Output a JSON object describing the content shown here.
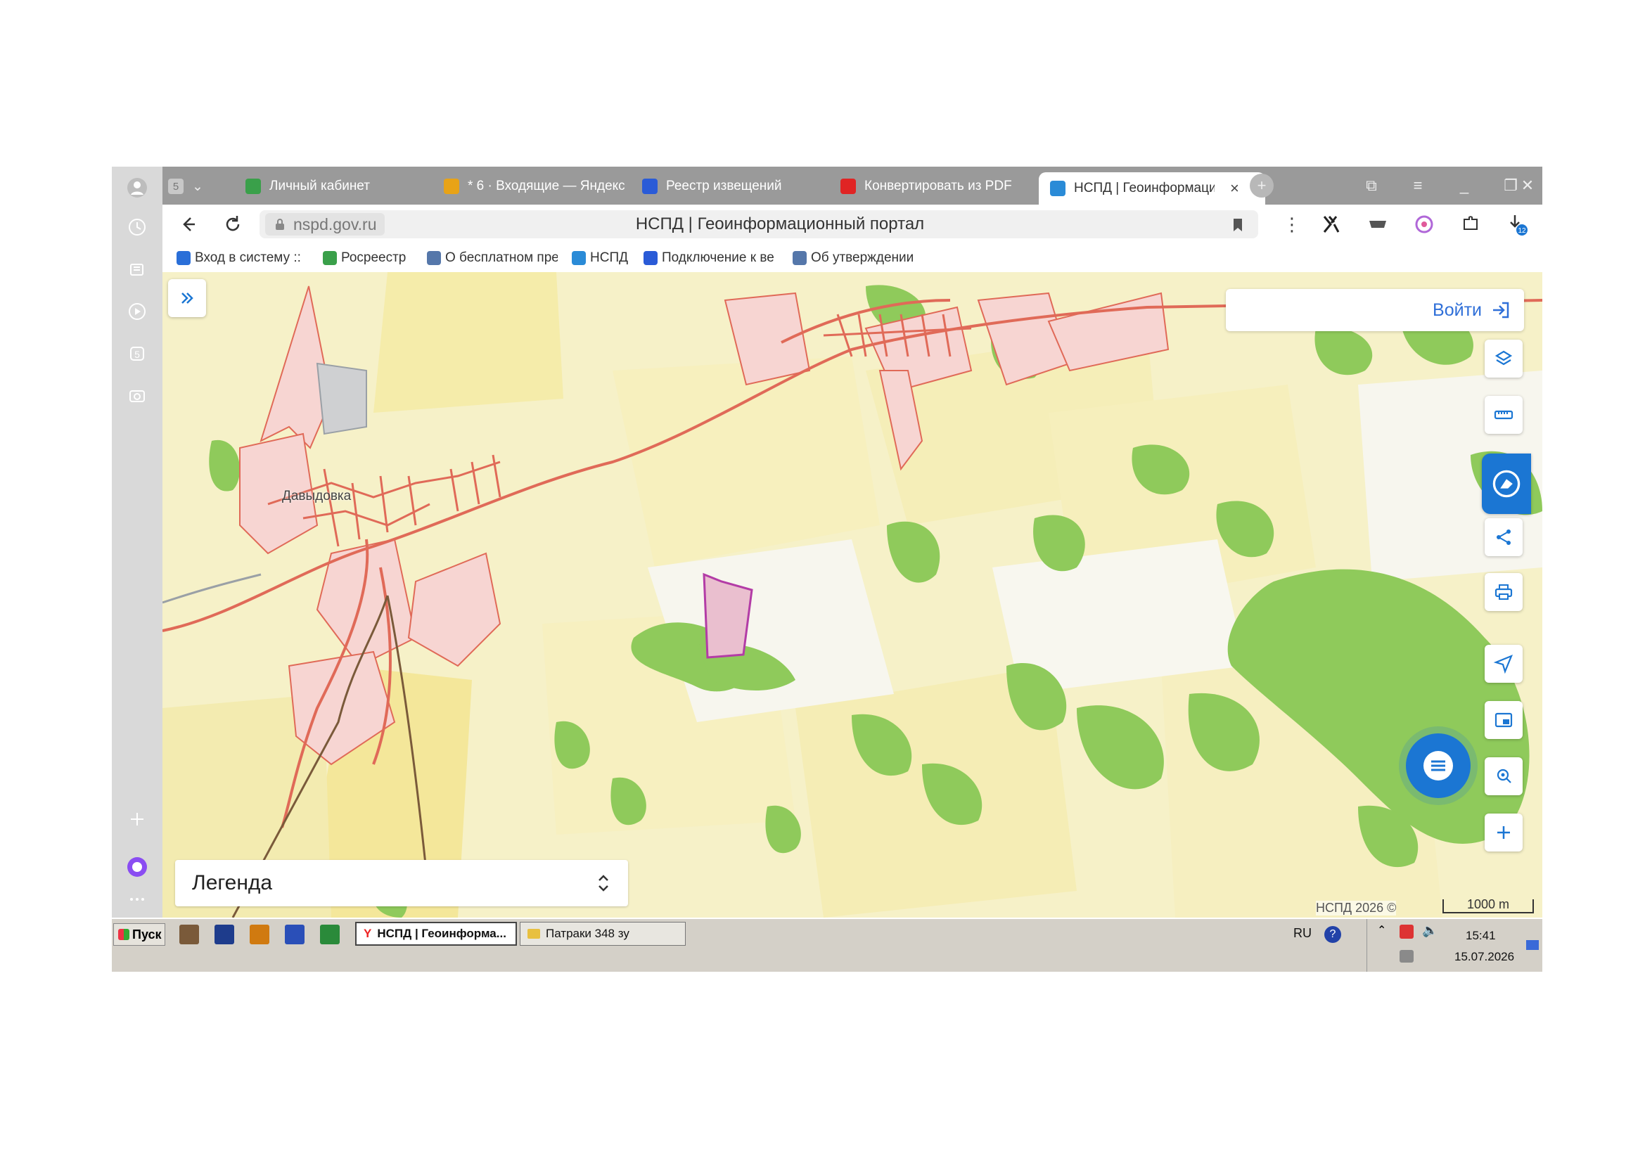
{
  "browser": {
    "tabs": [
      {
        "label": "Личный кабинет",
        "color": "#3aa04a"
      },
      {
        "label": "* 6 · Входящие — Яндекс",
        "color": "#e8a317"
      },
      {
        "label": "Реестр извещений",
        "color": "#2a5bd7"
      },
      {
        "label": "Конвертировать из PDF",
        "color": "#e02424"
      },
      {
        "label": "НСПД | Геоинформационный портал",
        "color": "#2a8bd7",
        "active": true
      }
    ],
    "sidebar_badge": "5",
    "url": "nspd.gov.ru",
    "page_title": "НСПД | Геоинформационный портал",
    "downloads_badge": "12",
    "bookmarks": [
      {
        "label": "Вход в систему ::",
        "color": "#2a6fd8"
      },
      {
        "label": "Росреестр",
        "color": "#3aa04a"
      },
      {
        "label": "О бесплатном пре",
        "color": "#5577aa"
      },
      {
        "label": "НСПД",
        "color": "#2a8bd7"
      },
      {
        "label": "Подключение к ве",
        "color": "#2a5bd7"
      },
      {
        "label": "Об утверждении",
        "color": "#5577aa"
      }
    ]
  },
  "map": {
    "place_label": "Давыдовка",
    "login_label": "Войти",
    "legend_label": "Легенда",
    "copyright": "НСПД 2026 ©",
    "scale_label": "1000 m",
    "tools": [
      "layers-icon",
      "ruler-icon",
      "assistant-icon",
      "share-icon",
      "print-icon",
      "locate-icon",
      "minimap-icon",
      "search-location-icon",
      "zoom-in-icon"
    ],
    "colors": {
      "fields": "#f5efbf",
      "forest": "#8fca5b",
      "settlement": "#f7d5d2",
      "road": "#e06a58",
      "parcel": "#b33ca6",
      "accent": "#1b76d3"
    }
  },
  "taskbar": {
    "start_label": "Пуск",
    "windows": [
      {
        "label": "НСПД | Геоинформа...",
        "active": true
      },
      {
        "label": "Патраки 348 зу",
        "active": false
      }
    ],
    "lang": "RU",
    "time": "15:41",
    "date": "15.07.2026"
  }
}
